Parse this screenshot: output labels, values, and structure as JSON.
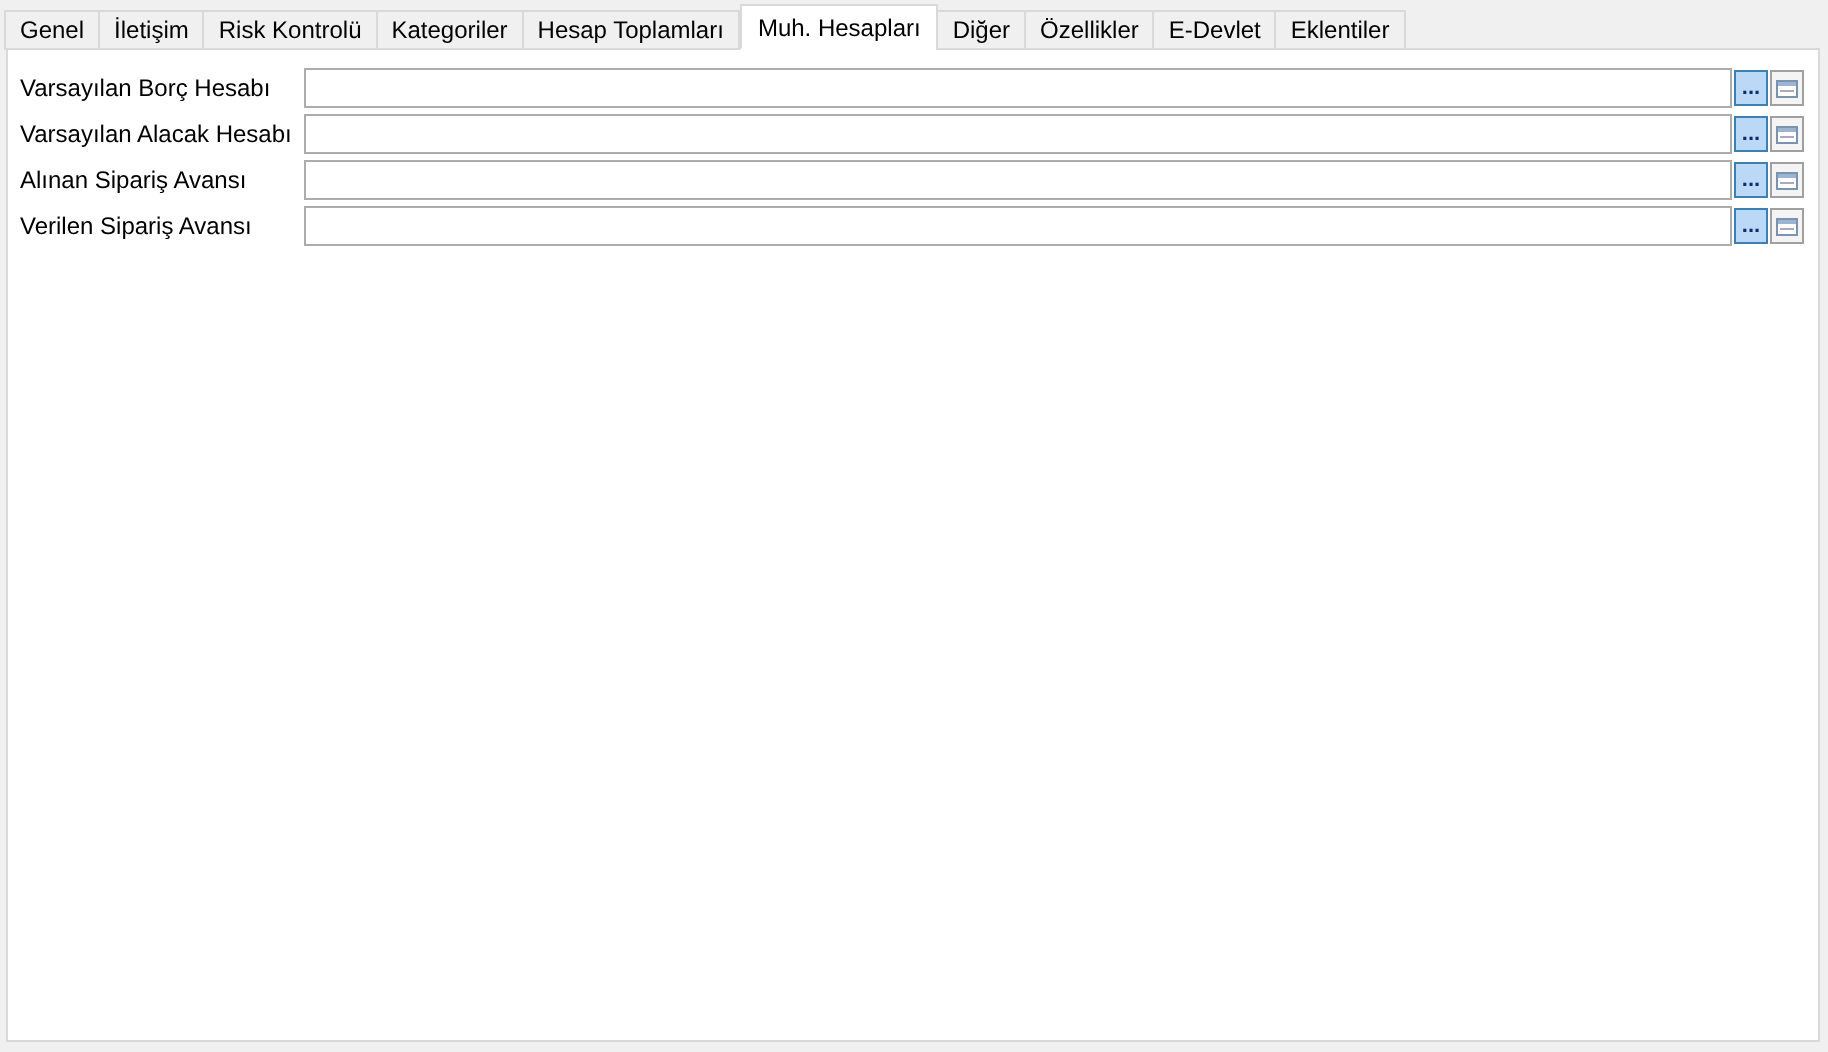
{
  "tabs": [
    {
      "label": "Genel",
      "selected": false
    },
    {
      "label": "İletişim",
      "selected": false
    },
    {
      "label": "Risk Kontrolü",
      "selected": false
    },
    {
      "label": "Kategoriler",
      "selected": false
    },
    {
      "label": "Hesap Toplamları",
      "selected": false
    },
    {
      "label": "Muh. Hesapları",
      "selected": true
    },
    {
      "label": "Diğer",
      "selected": false
    },
    {
      "label": "Özellikler",
      "selected": false
    },
    {
      "label": "E-Devlet",
      "selected": false
    },
    {
      "label": "Eklentiler",
      "selected": false
    }
  ],
  "fields": [
    {
      "label": "Varsayılan Borç Hesabı",
      "browse_button": "..."
    },
    {
      "label": "Varsayılan Alacak Hesabı",
      "browse_button": "..."
    },
    {
      "label": "Alınan Sipariş Avansı",
      "browse_button": "..."
    },
    {
      "label": "Verilen Sipariş Avansı",
      "browse_button": "..."
    }
  ]
}
